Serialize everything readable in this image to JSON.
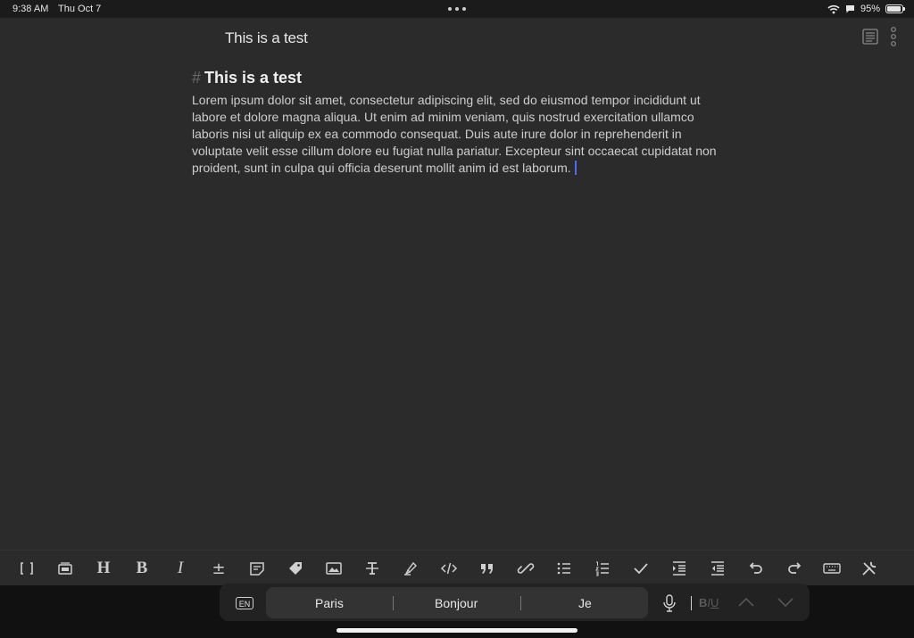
{
  "status_bar": {
    "time": "9:38 AM",
    "date": "Thu Oct 7",
    "battery_percent": "95%",
    "battery_level": 0.95,
    "icons": [
      "wifi-icon",
      "message-icon",
      "battery-icon"
    ]
  },
  "nav": {
    "title": "This is a test",
    "icons": [
      "outline-icon",
      "more-vertical-icon"
    ]
  },
  "document": {
    "heading_marker": "#",
    "heading": "This is a test",
    "body": "Lorem ipsum dolor sit amet, consectetur adipiscing elit, sed do eiusmod tempor incididunt ut labore et dolore magna aliqua. Ut enim ad minim veniam, quis nostrud exercitation ullamco laboris nisi ut aliquip ex ea commodo consequat. Duis aute irure dolor in reprehenderit in voluptate velit esse cillum dolore eu fugiat nulla pariatur. Excepteur sint occaecat cupidatat non proident, sunt in culpa qui officia deserunt mollit anim id est laborum."
  },
  "toolbar": {
    "heading_label": "H",
    "bold_label": "B",
    "italic_label": "I",
    "plus_minus_label": "±",
    "icons": [
      "wikilink-icon",
      "embed-icon",
      "heading-icon",
      "bold-icon",
      "italic-icon",
      "plus-minus-icon",
      "note-icon",
      "tag-icon",
      "image-icon",
      "strikethrough-icon",
      "highlight-icon",
      "code-icon",
      "quote-icon",
      "link-icon",
      "bullet-list-icon",
      "numbered-list-icon",
      "checkbox-icon",
      "indent-icon",
      "outdent-icon",
      "undo-icon",
      "redo-icon",
      "keyboard-icon",
      "tools-icon"
    ]
  },
  "keyboard_bar": {
    "language": "EN",
    "suggestions": [
      "Paris",
      "Bonjour",
      "Je"
    ],
    "format_label_b": "B",
    "format_label_i": "I",
    "format_label_u": "U"
  },
  "colors": {
    "background": "#2b2b2b",
    "caret": "#4a6cf7",
    "text": "#cdcdcd"
  }
}
